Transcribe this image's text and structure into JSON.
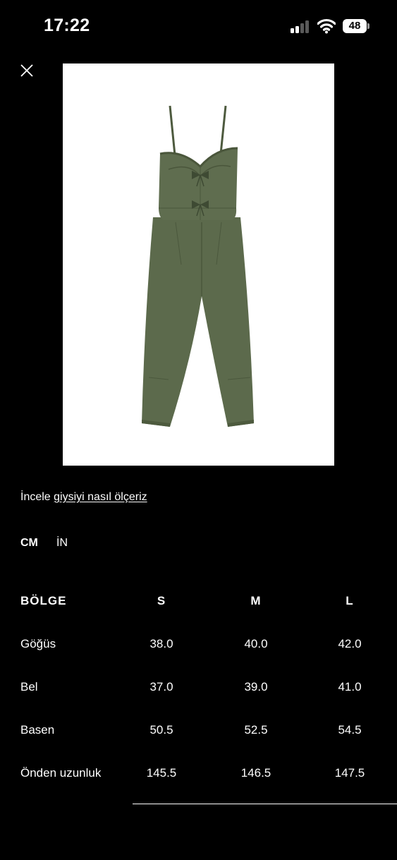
{
  "status_bar": {
    "time": "17:22",
    "battery": "48"
  },
  "measure_note": {
    "prefix": "İncele ",
    "link": "giysiyi nasıl ölçeriz"
  },
  "units": {
    "cm": "CM",
    "in": "İN",
    "active": "CM"
  },
  "table": {
    "headers": [
      "BÖLGE",
      "S",
      "M",
      "L"
    ],
    "rows": [
      [
        "Göğüs",
        "38.0",
        "40.0",
        "42.0"
      ],
      [
        "Bel",
        "37.0",
        "39.0",
        "41.0"
      ],
      [
        "Basen",
        "50.5",
        "52.5",
        "54.5"
      ],
      [
        "Önden uzunluk",
        "145.5",
        "146.5",
        "147.5"
      ]
    ]
  },
  "colors": {
    "background": "#000000",
    "text": "#ffffff",
    "garment": "#5c6a4c"
  },
  "icons": [
    "close-icon",
    "cellular-signal-icon",
    "wifi-icon",
    "battery-icon"
  ]
}
